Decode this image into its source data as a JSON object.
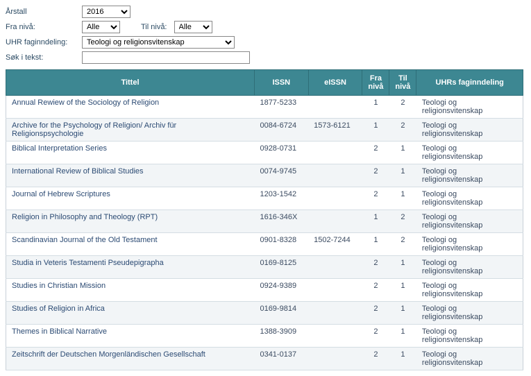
{
  "filters": {
    "year_label": "Årstall",
    "year_value": "2016",
    "fra_niva_label": "Fra nivå:",
    "fra_niva_value": "Alle",
    "til_niva_label": "Til nivå:",
    "til_niva_value": "Alle",
    "fag_label": "UHR faginndeling:",
    "fag_value": "Teologi og religionsvitenskap",
    "search_label": "Søk i tekst:",
    "search_value": ""
  },
  "columns": {
    "title": "Tittel",
    "issn": "ISSN",
    "eissn": "eISSN",
    "fra": "Fra nivå",
    "til": "Til nivå",
    "fag": "UHRs faginndeling"
  },
  "rows": [
    {
      "title": "Annual Rewiew of the Sociology of Religion",
      "issn": "1877-5233",
      "eissn": "",
      "fra": "1",
      "til": "2",
      "fag": "Teologi og religionsvitenskap"
    },
    {
      "title": "Archive for the Psychology of Religion/ Archiv für Religionspsychologie",
      "issn": "0084-6724",
      "eissn": "1573-6121",
      "fra": "1",
      "til": "2",
      "fag": "Teologi og religionsvitenskap"
    },
    {
      "title": "Biblical Interpretation Series",
      "issn": "0928-0731",
      "eissn": "",
      "fra": "2",
      "til": "1",
      "fag": "Teologi og religionsvitenskap"
    },
    {
      "title": "International Review of Biblical Studies",
      "issn": "0074-9745",
      "eissn": "",
      "fra": "2",
      "til": "1",
      "fag": "Teologi og religionsvitenskap"
    },
    {
      "title": "Journal of Hebrew Scriptures",
      "issn": "1203-1542",
      "eissn": "",
      "fra": "2",
      "til": "1",
      "fag": "Teologi og religionsvitenskap"
    },
    {
      "title": "Religion in Philosophy and Theology (RPT)",
      "issn": "1616-346X",
      "eissn": "",
      "fra": "1",
      "til": "2",
      "fag": "Teologi og religionsvitenskap"
    },
    {
      "title": "Scandinavian Journal of the Old Testament",
      "issn": "0901-8328",
      "eissn": "1502-7244",
      "fra": "1",
      "til": "2",
      "fag": "Teologi og religionsvitenskap"
    },
    {
      "title": "Studia in Veteris Testamenti Pseudepigrapha",
      "issn": "0169-8125",
      "eissn": "",
      "fra": "2",
      "til": "1",
      "fag": "Teologi og religionsvitenskap"
    },
    {
      "title": "Studies in Christian Mission",
      "issn": "0924-9389",
      "eissn": "",
      "fra": "2",
      "til": "1",
      "fag": "Teologi og religionsvitenskap"
    },
    {
      "title": "Studies of Religion in Africa",
      "issn": "0169-9814",
      "eissn": "",
      "fra": "2",
      "til": "1",
      "fag": "Teologi og religionsvitenskap"
    },
    {
      "title": "Themes in Biblical Narrative",
      "issn": "1388-3909",
      "eissn": "",
      "fra": "2",
      "til": "1",
      "fag": "Teologi og religionsvitenskap"
    },
    {
      "title": "Zeitschrift der Deutschen Morgenländischen Gesellschaft",
      "issn": "0341-0137",
      "eissn": "",
      "fra": "2",
      "til": "1",
      "fag": "Teologi og religionsvitenskap"
    }
  ]
}
